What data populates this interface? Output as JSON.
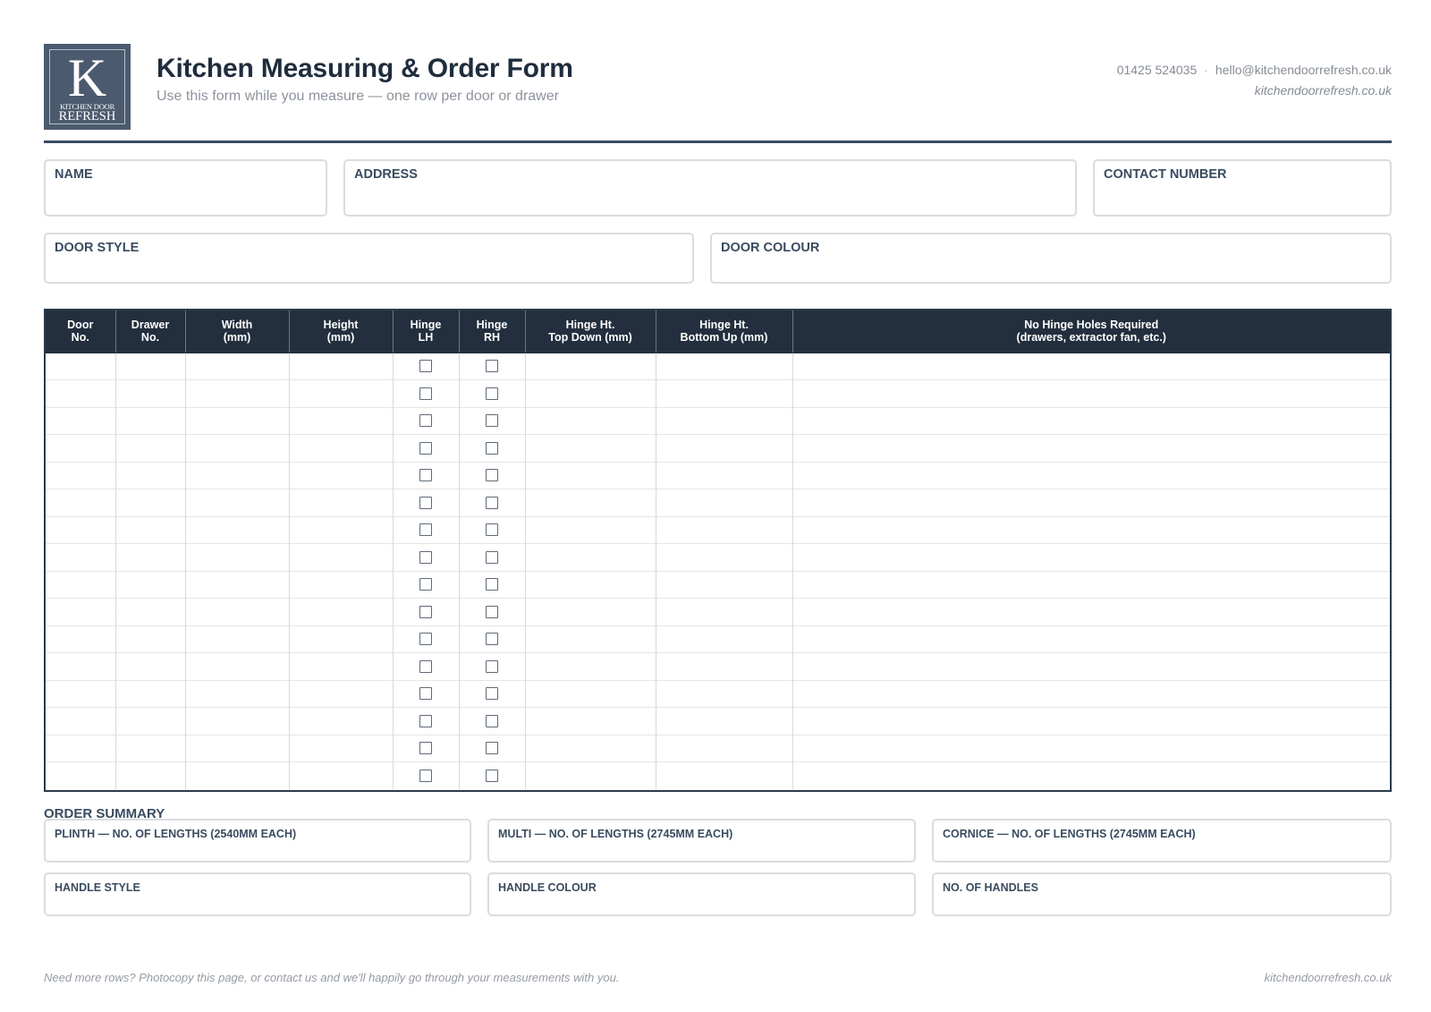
{
  "brand": {
    "logo_letter": "K",
    "logo_line1": "KITCHEN DOOR",
    "logo_line2": "REFRESH",
    "logo_color": "#4b5a6e",
    "accent_color": "#232f3e"
  },
  "header": {
    "title": "Kitchen Measuring & Order Form",
    "subtitle": "Use this form while you measure — one row per door or drawer",
    "phone": "01425 524035",
    "separator": "·",
    "email": "hello@kitchendoorrefresh.co.uk",
    "website": "kitchendoorrefresh.co.uk"
  },
  "customer_fields": {
    "name": "NAME",
    "address": "ADDRESS",
    "contact_number": "CONTACT NUMBER",
    "door_style": "DOOR STYLE",
    "door_colour": "DOOR COLOUR"
  },
  "table": {
    "columns": [
      {
        "line1": "Door",
        "line2": "No."
      },
      {
        "line1": "Drawer",
        "line2": "No."
      },
      {
        "line1": "Width",
        "line2": "(mm)"
      },
      {
        "line1": "Height",
        "line2": "(mm)"
      },
      {
        "line1": "Hinge",
        "line2": "LH"
      },
      {
        "line1": "Hinge",
        "line2": "RH"
      },
      {
        "line1": "Hinge Ht.",
        "line2": "Top Down (mm)"
      },
      {
        "line1": "Hinge Ht.",
        "line2": "Bottom Up (mm)"
      },
      {
        "line1": "No Hinge Holes Required",
        "line2": "(drawers, extractor fan, etc.)"
      }
    ],
    "row_count": 16,
    "checkbox_columns": [
      4,
      5
    ]
  },
  "order_summary": {
    "title": "ORDER SUMMARY",
    "plinth": "PLINTH — NO. OF LENGTHS (2540MM EACH)",
    "multi": "MULTI — NO. OF LENGTHS (2745MM EACH)",
    "cornice": "CORNICE — NO. OF LENGTHS (2745MM EACH)",
    "handle_style": "HANDLE STYLE",
    "handle_colour": "HANDLE COLOUR",
    "no_of_handles": "NO. OF HANDLES"
  },
  "footer": {
    "note": "Need more rows? Photocopy this page, or contact us and we'll happily go through your measurements with you.",
    "website": "kitchendoorrefresh.co.uk"
  }
}
